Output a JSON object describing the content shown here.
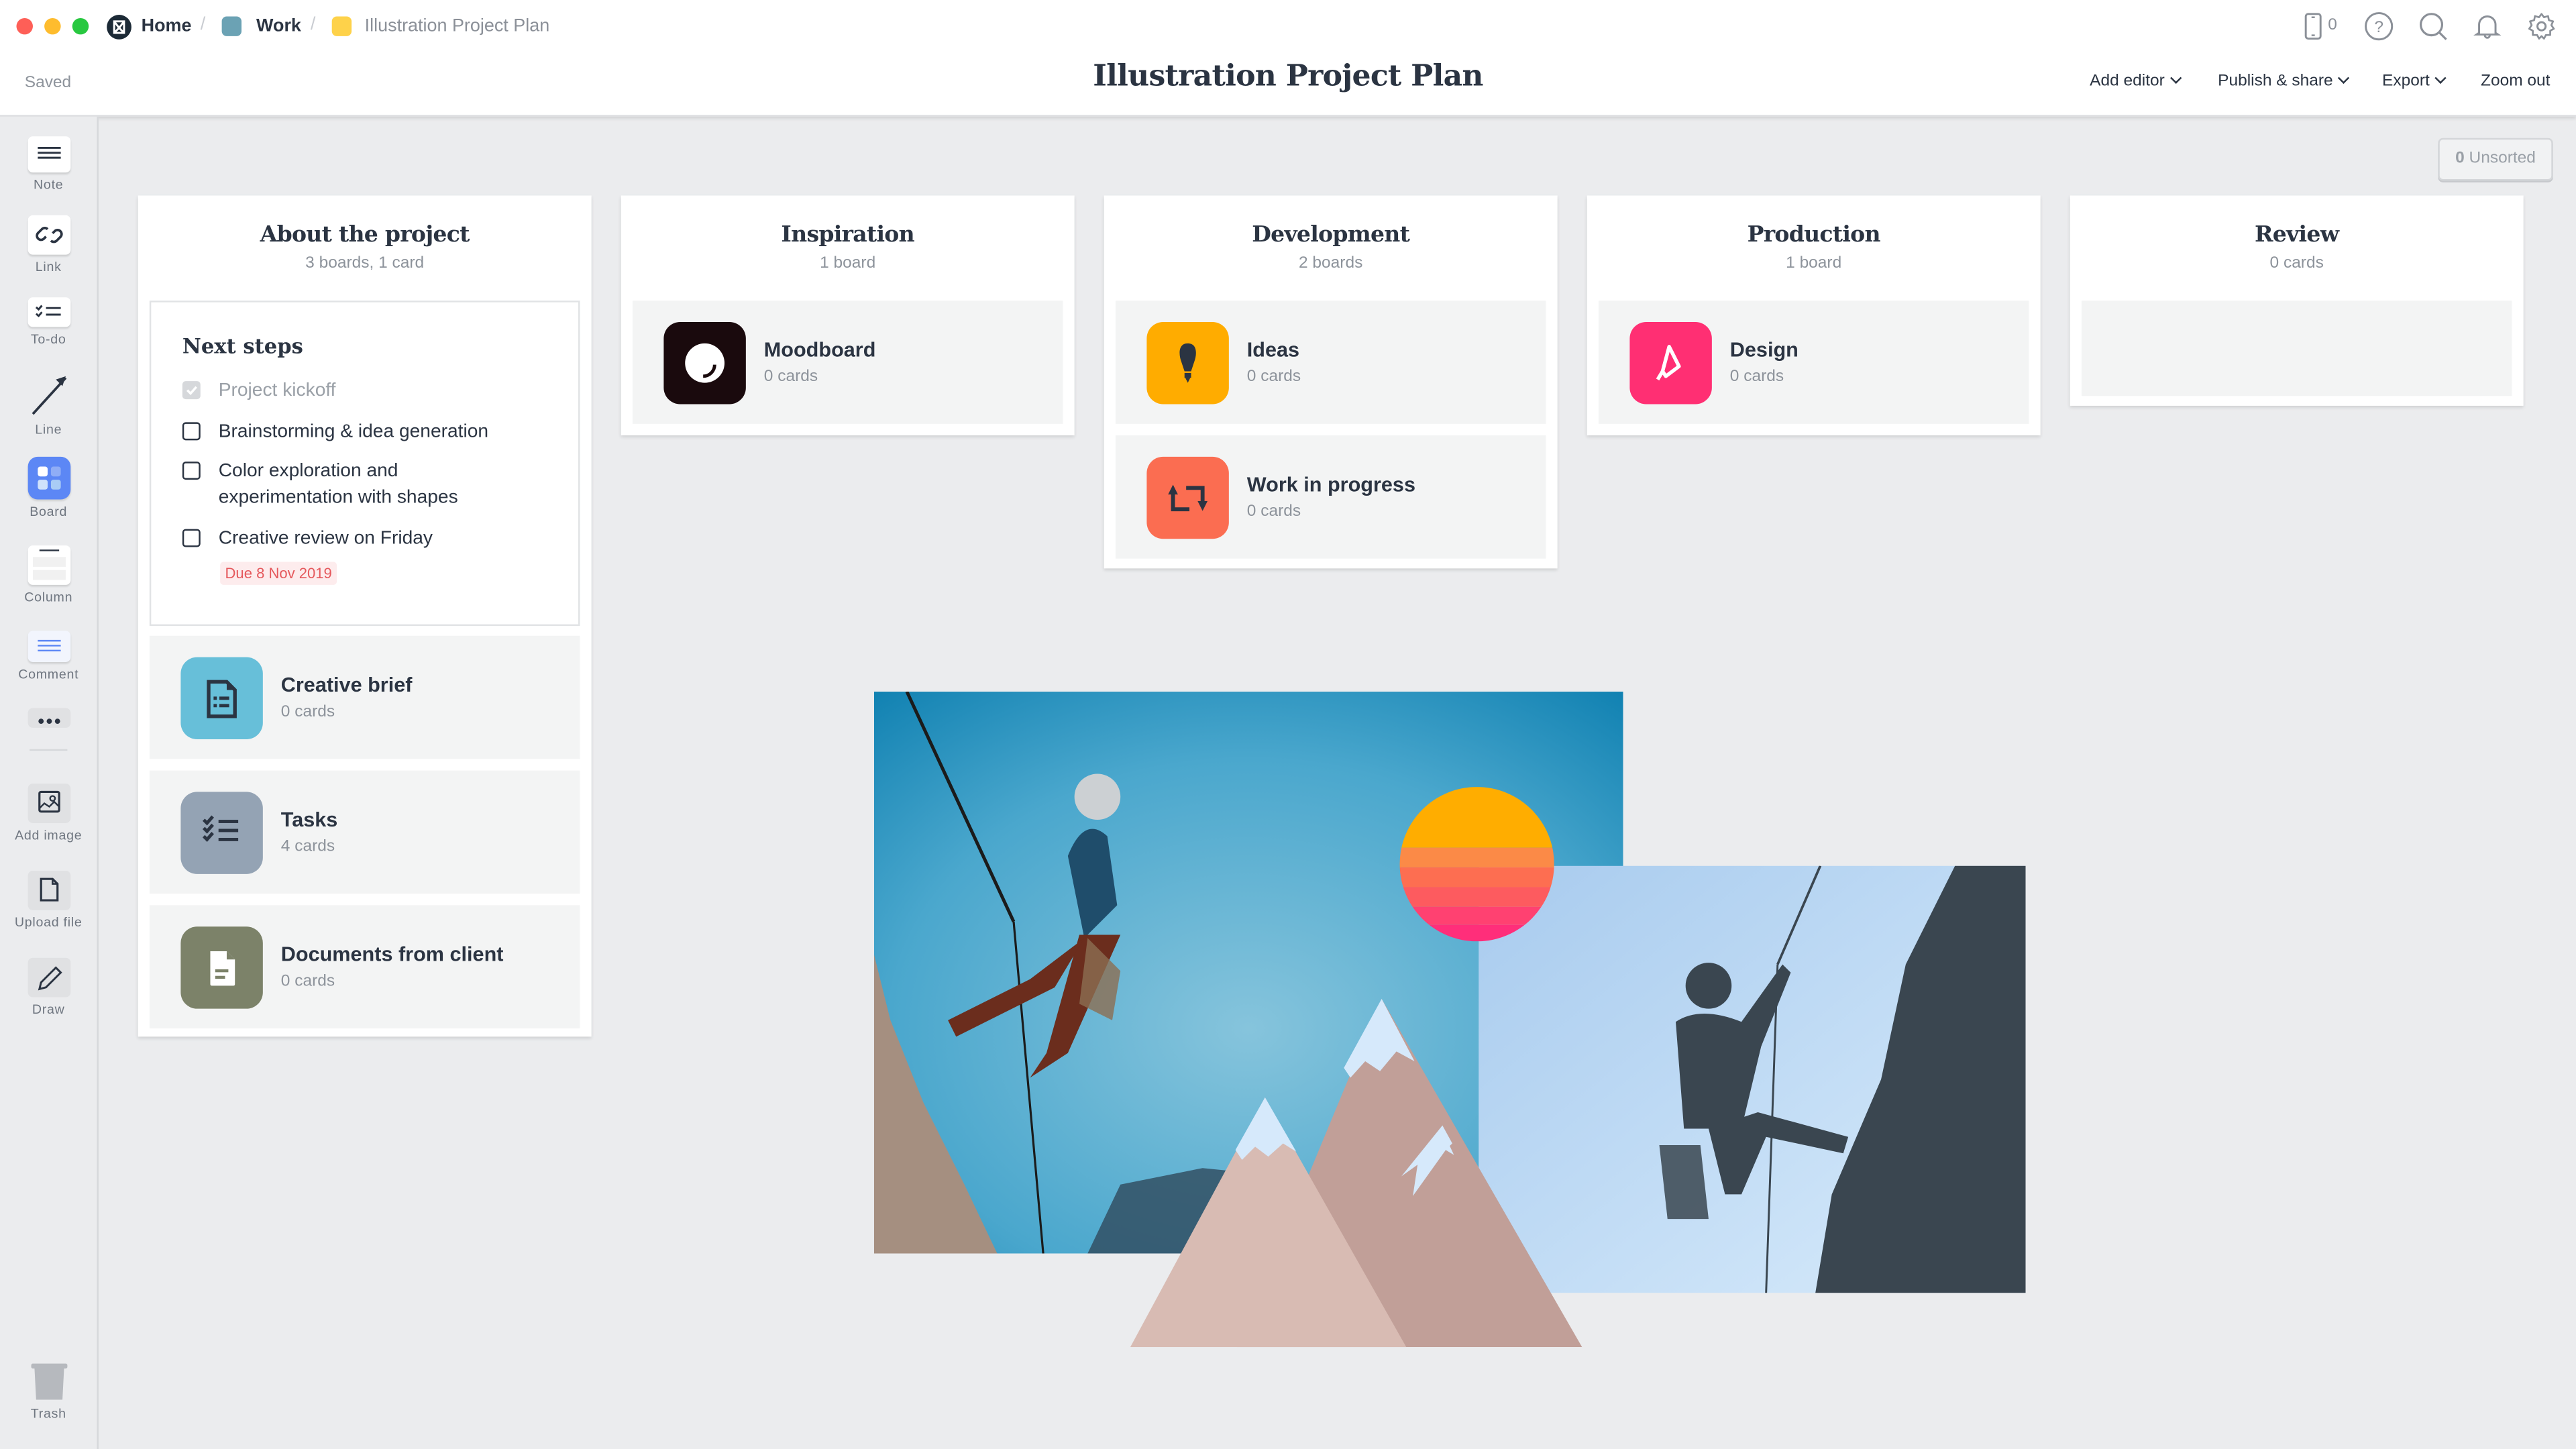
{
  "window": {
    "traffic_lights": {
      "close": "#fe5f57",
      "minimize": "#febc2e",
      "maximize": "#28c840"
    }
  },
  "breadcrumb": [
    {
      "label": "Home",
      "icon": "milanote-logo-icon",
      "color": "#1c2a36"
    },
    {
      "label": "Work",
      "icon": "board-square-icon",
      "color": "#6ba2b4"
    },
    {
      "label": "Illustration Project Plan",
      "icon": "board-square-icon",
      "color": "#fed24a"
    }
  ],
  "header": {
    "status": "Saved",
    "title": "Illustration Project Plan",
    "device_count": "0",
    "menus": {
      "add_editor": "Add editor",
      "publish_share": "Publish & share",
      "export": "Export",
      "zoom_out": "Zoom out"
    },
    "icons": [
      "mobile-device-icon",
      "help-icon",
      "search-icon",
      "bell-icon",
      "gear-icon"
    ]
  },
  "sidebar": {
    "tools": [
      {
        "label": "Note",
        "icon": "note-icon"
      },
      {
        "label": "Link",
        "icon": "link-icon"
      },
      {
        "label": "To-do",
        "icon": "todo-icon"
      },
      {
        "label": "Line",
        "icon": "line-arrow-icon"
      },
      {
        "label": "Board",
        "icon": "board-icon"
      },
      {
        "label": "Column",
        "icon": "column-icon"
      },
      {
        "label": "Comment",
        "icon": "comment-icon"
      },
      {
        "label": "",
        "icon": "more-icon"
      },
      {
        "label": "Add image",
        "icon": "image-icon"
      },
      {
        "label": "Upload file",
        "icon": "file-icon"
      },
      {
        "label": "Draw",
        "icon": "pencil-icon"
      }
    ],
    "trash": {
      "label": "Trash",
      "icon": "trash-icon"
    }
  },
  "unsorted": {
    "count": "0",
    "label": "Unsorted"
  },
  "columns": [
    {
      "title": "About the project",
      "subtitle": "3 boards, 1 card",
      "todo": {
        "title": "Next steps",
        "items": [
          {
            "text": "Project kickoff",
            "checked": true
          },
          {
            "text": "Brainstorming & idea generation",
            "checked": false
          },
          {
            "text": "Color exploration and",
            "text2": "experimentation with shapes",
            "checked": false
          },
          {
            "text": "Creative review on Friday",
            "checked": false
          }
        ],
        "due": "Due 8 Nov 2019"
      },
      "boards": [
        {
          "name": "Creative brief",
          "count": "0 cards",
          "color": "#67bfd9",
          "icon": "document-list-icon"
        },
        {
          "name": "Tasks",
          "count": "4 cards",
          "color": "#94a3b4",
          "icon": "checklist-icon"
        },
        {
          "name": "Documents from client",
          "count": "0 cards",
          "color": "#7c8269",
          "icon": "document-icon"
        }
      ]
    },
    {
      "title": "Inspiration",
      "subtitle": "1 board",
      "boards": [
        {
          "name": "Moodboard",
          "count": "0 cards",
          "color": "#1a0a0d",
          "icon": "moodboard-circle-icon"
        }
      ]
    },
    {
      "title": "Development",
      "subtitle": "2 boards",
      "boards": [
        {
          "name": "Ideas",
          "count": "0 cards",
          "color": "#ffac00",
          "icon": "lightbulb-icon"
        },
        {
          "name": "Work in progress",
          "count": "0 cards",
          "color": "#fb6d51",
          "icon": "repeat-arrows-icon"
        }
      ]
    },
    {
      "title": "Production",
      "subtitle": "1 board",
      "boards": [
        {
          "name": "Design",
          "count": "0 cards",
          "color": "#ff2f73",
          "icon": "pen-nib-icon"
        }
      ]
    },
    {
      "title": "Review",
      "subtitle": "0 cards",
      "boards": []
    }
  ],
  "canvas_images": [
    {
      "name": "climber-photo",
      "description": "Rock climber with helmet on blue sky background"
    },
    {
      "name": "sunset-sun-illustration",
      "colors": [
        "#ffad00",
        "#fb8a47",
        "#fd6e51",
        "#fd5b5f",
        "#ff4171",
        "#ff2e7a"
      ]
    },
    {
      "name": "mountains-illustration",
      "colors": [
        "#d8bbb3",
        "#c19f98",
        "#d6e9fb"
      ]
    },
    {
      "name": "climber-silhouette-photo",
      "description": "Silhouette of climber on rock face against light blue sky"
    }
  ]
}
